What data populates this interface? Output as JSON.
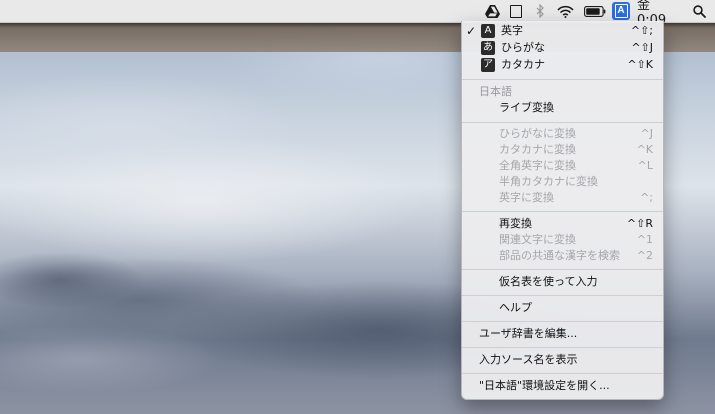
{
  "menubar": {
    "icons": [
      "google-drive-icon",
      "square-icon",
      "bluetooth-icon",
      "wifi-icon",
      "battery-icon",
      "search-icon"
    ],
    "input_source_letter": "A",
    "clock": "金 0:09"
  },
  "menu": {
    "sources": [
      {
        "label": "英字",
        "icon": "A",
        "shortcut": "^⇧;",
        "checked": true
      },
      {
        "label": "ひらがな",
        "icon": "あ",
        "shortcut": "^⇧J",
        "checked": false
      },
      {
        "label": "カタカナ",
        "icon": "ア",
        "shortcut": "^⇧K",
        "checked": false
      }
    ],
    "section_header": "日本語",
    "live_conversion": "ライブ変換",
    "convert_items": [
      {
        "label": "ひらがなに変換",
        "shortcut": "^J"
      },
      {
        "label": "カタカナに変換",
        "shortcut": "^K"
      },
      {
        "label": "全角英字に変換",
        "shortcut": "^L"
      },
      {
        "label": "半角カタカナに変換",
        "shortcut": ""
      },
      {
        "label": "英字に変換",
        "shortcut": "^;"
      }
    ],
    "reconvert": {
      "label": "再変換",
      "shortcut": "^⇧R"
    },
    "related_chars": {
      "label": "関連文字に変換",
      "shortcut": "^1"
    },
    "common_kanji": {
      "label": "部品の共通な漢字を検索",
      "shortcut": "^2"
    },
    "kana_table": "仮名表を使って入力",
    "help": "ヘルプ",
    "user_dict": "ユーザ辞書を編集...",
    "show_source_name": "入力ソース名を表示",
    "open_prefs": "\"日本語\"環境設定を開く..."
  }
}
